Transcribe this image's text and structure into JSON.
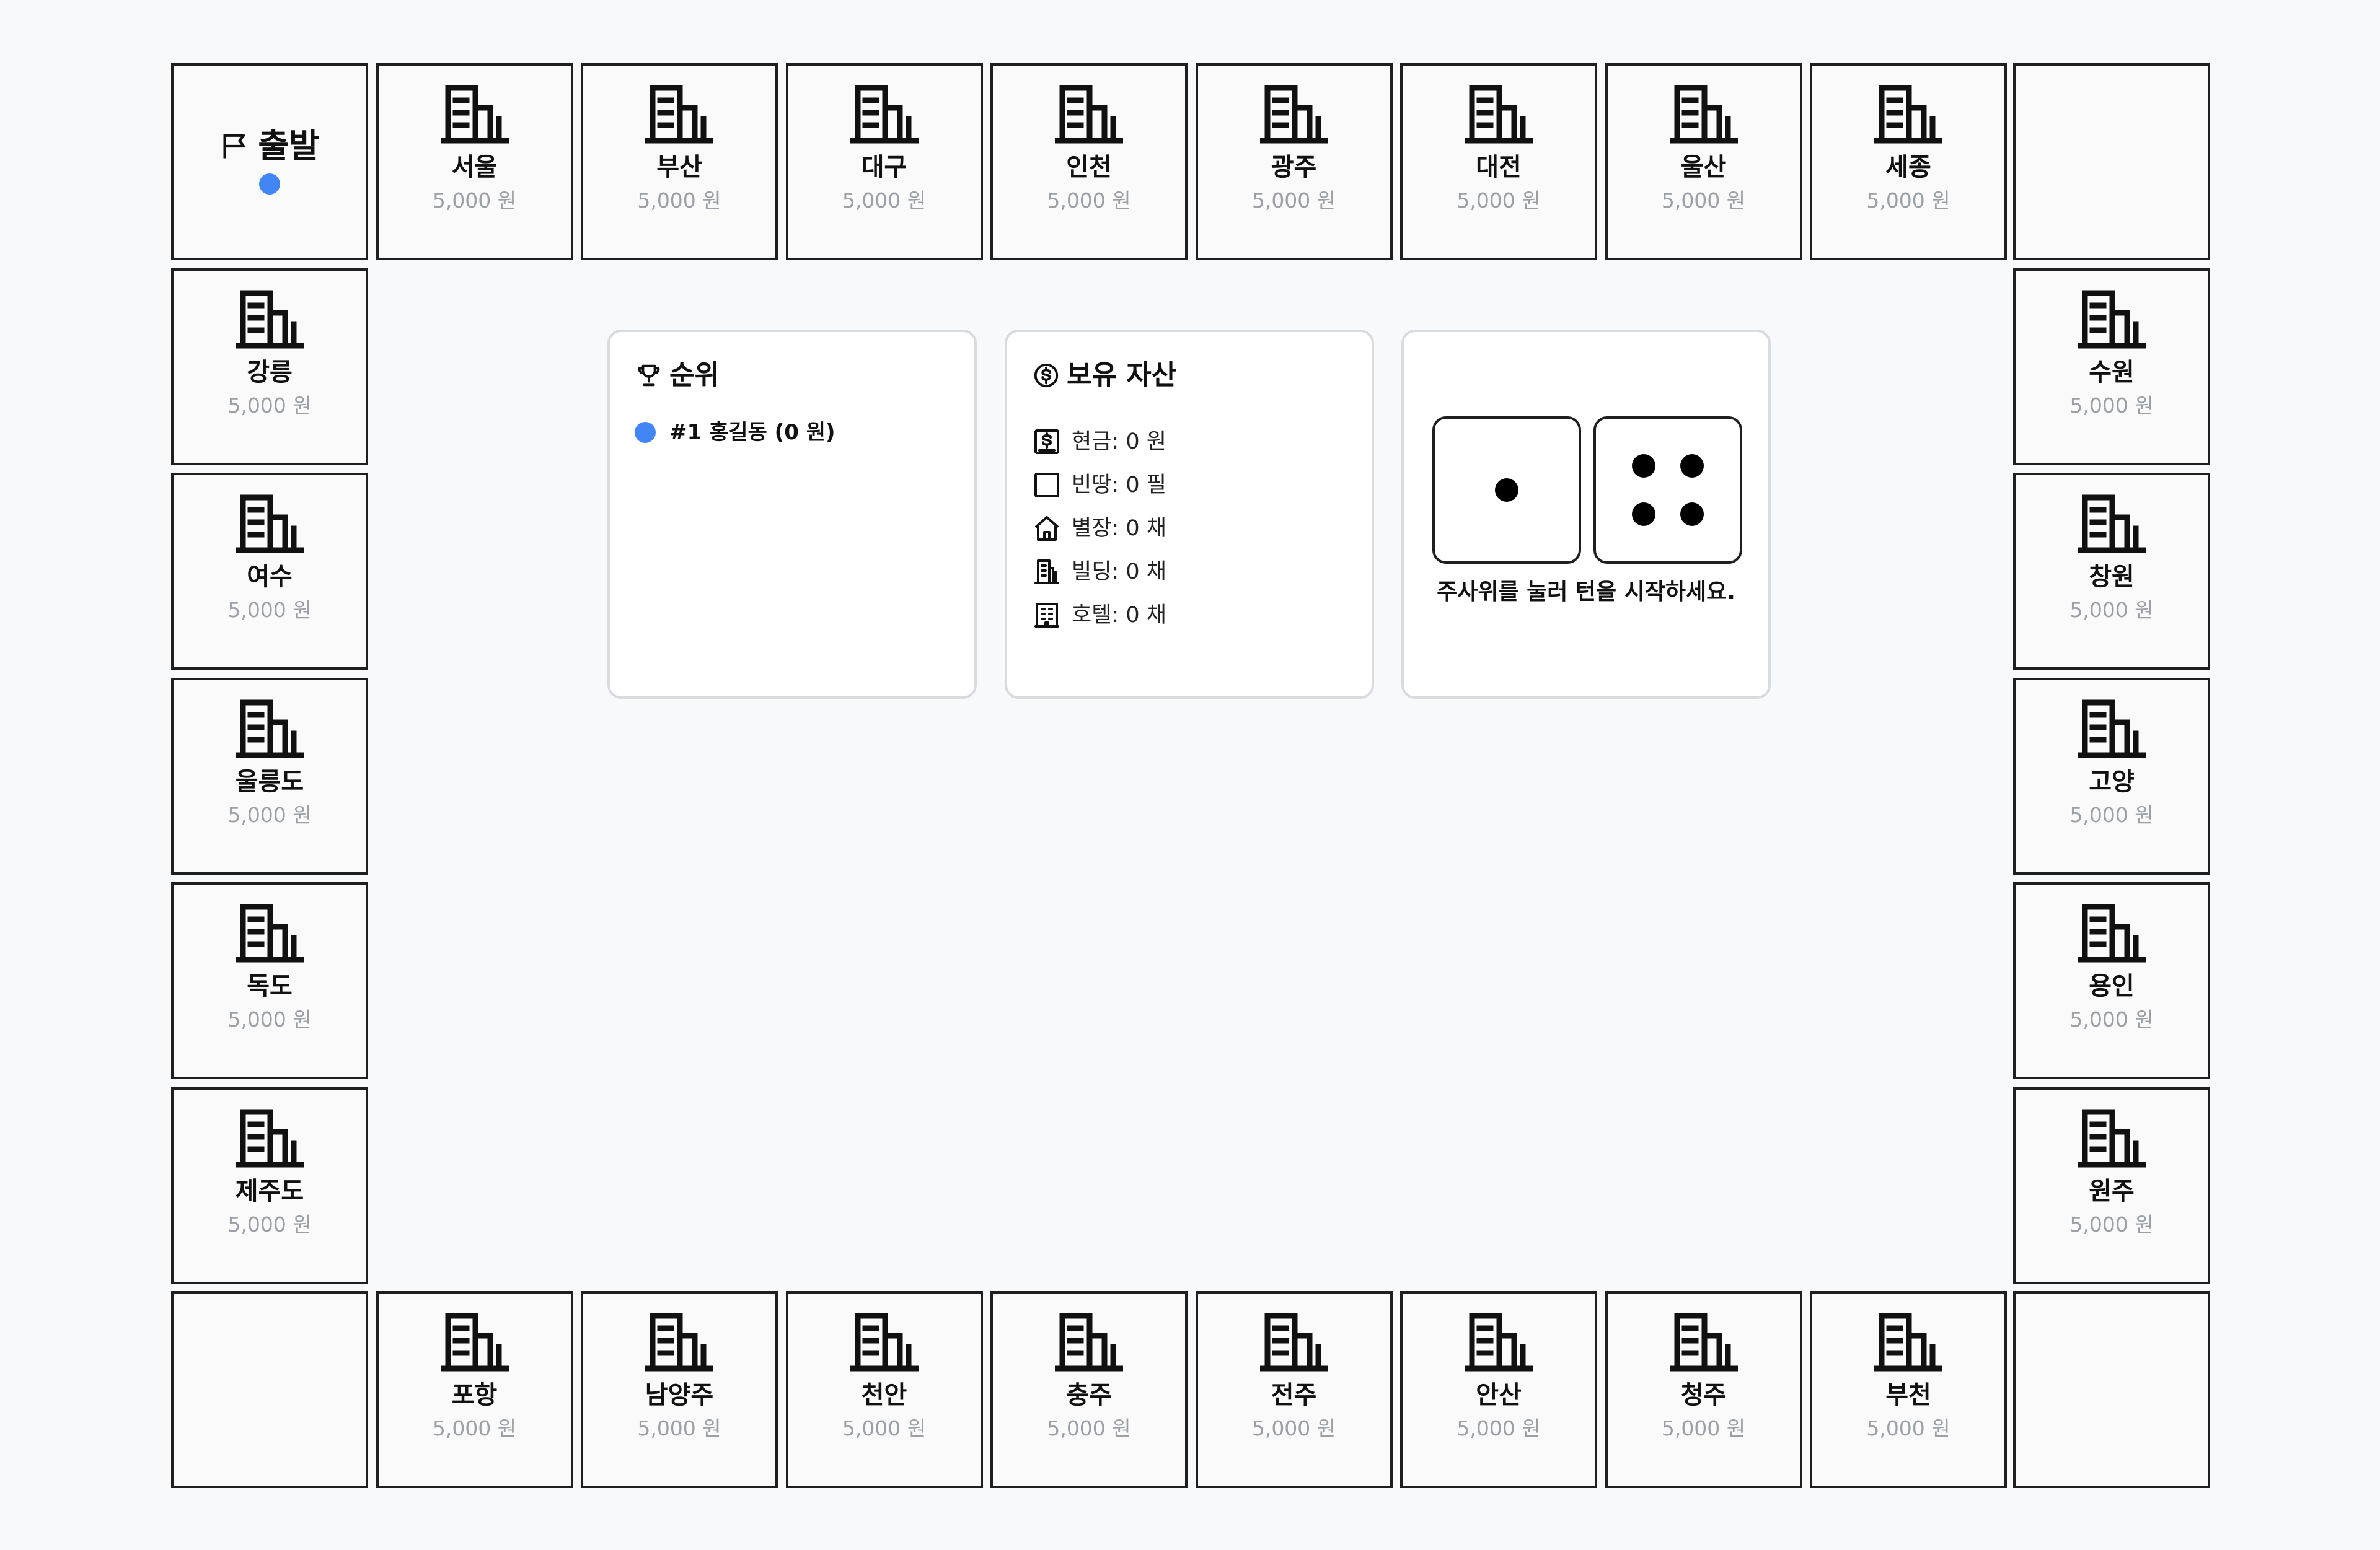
{
  "start": {
    "label": "출발"
  },
  "price_label": "5,000 원",
  "cities": {
    "top": [
      "서울",
      "부산",
      "대구",
      "인천",
      "광주",
      "대전",
      "울산",
      "세종"
    ],
    "left": [
      "강릉",
      "여수",
      "울릉도",
      "독도",
      "제주도"
    ],
    "right": [
      "수원",
      "창원",
      "고양",
      "용인",
      "원주"
    ],
    "bottom": [
      "포항",
      "남양주",
      "천안",
      "충주",
      "전주",
      "안산",
      "청주",
      "부천"
    ]
  },
  "ranking": {
    "title": "순위",
    "players": [
      {
        "text": "#1 홍길동 (0 원)",
        "color": "#4285f4"
      }
    ]
  },
  "assets": {
    "title": "보유 자산",
    "items": [
      {
        "icon": "cash-icon",
        "text": "현금: 0 원"
      },
      {
        "icon": "empty-lot-icon",
        "text": "빈땅: 0 필"
      },
      {
        "icon": "house-icon",
        "text": "별장: 0 채"
      },
      {
        "icon": "building-icon",
        "text": "빌딩: 0 채"
      },
      {
        "icon": "hotel-icon",
        "text": "호텔: 0 채"
      }
    ]
  },
  "dice": {
    "values": [
      1,
      4
    ],
    "message": "주사위를 눌러 턴을 시작하세요."
  },
  "colors": {
    "token": "#4285f4",
    "border": "#1f1f1f",
    "muted": "#9aa0a6"
  }
}
